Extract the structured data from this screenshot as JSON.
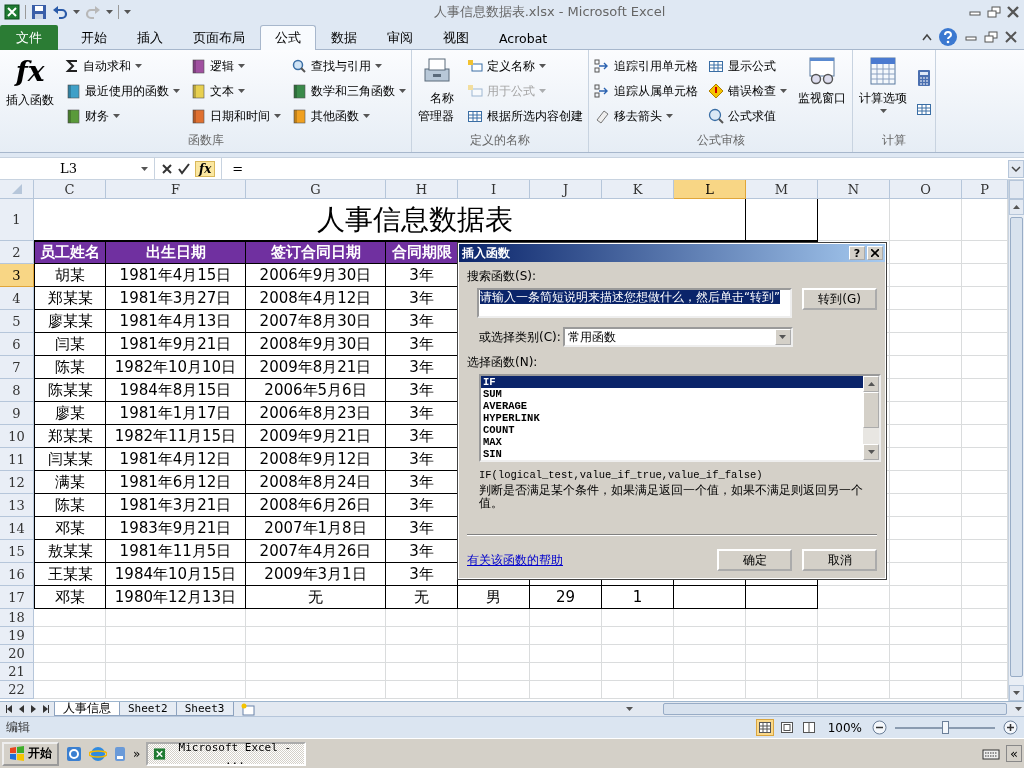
{
  "window": {
    "title": "人事信息数据表.xlsx - Microsoft Excel"
  },
  "ribbon_tabs": [
    {
      "label": "文件",
      "kind": "file",
      "selected": false
    },
    {
      "label": "开始",
      "kind": "tab",
      "selected": false
    },
    {
      "label": "插入",
      "kind": "tab",
      "selected": false
    },
    {
      "label": "页面布局",
      "kind": "tab",
      "selected": false
    },
    {
      "label": "公式",
      "kind": "tab",
      "selected": true
    },
    {
      "label": "数据",
      "kind": "tab",
      "selected": false
    },
    {
      "label": "审阅",
      "kind": "tab",
      "selected": false
    },
    {
      "label": "视图",
      "kind": "tab",
      "selected": false
    },
    {
      "label": "Acrobat",
      "kind": "tab",
      "selected": false
    }
  ],
  "ribbon_groups": [
    {
      "label": "函数库",
      "parts": [
        {
          "kind": "large",
          "label": "插入函数",
          "icon_text": "fx",
          "dropdown": false
        },
        {
          "kind": "column",
          "items": [
            {
              "label": "自动求和",
              "dropdown": true,
              "disabled": false
            },
            {
              "label": "最近使用的函数",
              "dropdown": true,
              "disabled": false
            },
            {
              "label": "财务",
              "dropdown": true,
              "disabled": false
            }
          ]
        },
        {
          "kind": "column",
          "items": [
            {
              "label": "逻辑",
              "dropdown": true,
              "disabled": false
            },
            {
              "label": "文本",
              "dropdown": true,
              "disabled": false
            },
            {
              "label": "日期和时间",
              "dropdown": true,
              "disabled": false
            }
          ]
        },
        {
          "kind": "column",
          "items": [
            {
              "label": "查找与引用",
              "dropdown": true,
              "disabled": false
            },
            {
              "label": "数学和三角函数",
              "dropdown": true,
              "disabled": false
            },
            {
              "label": "其他函数",
              "dropdown": true,
              "disabled": false
            }
          ]
        }
      ]
    },
    {
      "label": "定义的名称",
      "parts": [
        {
          "kind": "large",
          "label": "名称管理器",
          "dropdown": false
        },
        {
          "kind": "column",
          "items": [
            {
              "label": "定义名称",
              "dropdown": true,
              "disabled": false
            },
            {
              "label": "用于公式",
              "dropdown": true,
              "disabled": true
            },
            {
              "label": "根据所选内容创建",
              "dropdown": false,
              "disabled": false
            }
          ]
        }
      ]
    },
    {
      "label": "公式审核",
      "parts": [
        {
          "kind": "column",
          "items": [
            {
              "label": "追踪引用单元格",
              "dropdown": false,
              "disabled": false
            },
            {
              "label": "追踪从属单元格",
              "dropdown": false,
              "disabled": false
            },
            {
              "label": "移去箭头",
              "dropdown": true,
              "disabled": false
            }
          ]
        },
        {
          "kind": "column",
          "items": [
            {
              "label": "显示公式",
              "dropdown": false,
              "disabled": false
            },
            {
              "label": "错误检查",
              "dropdown": true,
              "disabled": false
            },
            {
              "label": "公式求值",
              "dropdown": false,
              "disabled": false
            }
          ]
        },
        {
          "kind": "large",
          "label": "监视窗口",
          "dropdown": false
        }
      ]
    },
    {
      "label": "计算",
      "parts": [
        {
          "kind": "large",
          "label": "计算选项",
          "dropdown": true
        },
        {
          "kind": "icon_column"
        }
      ]
    }
  ],
  "formula_bar": {
    "name_box": "L3",
    "fx_button": "fx",
    "formula": "="
  },
  "sheet": {
    "columns": [
      {
        "label": "C",
        "selected": false
      },
      {
        "label": "F",
        "selected": false
      },
      {
        "label": "G",
        "selected": false
      },
      {
        "label": "H",
        "selected": false
      },
      {
        "label": "I",
        "selected": false
      },
      {
        "label": "J",
        "selected": false
      },
      {
        "label": "K",
        "selected": false
      },
      {
        "label": "L",
        "selected": true
      },
      {
        "label": "M",
        "selected": false
      },
      {
        "label": "N",
        "selected": false
      },
      {
        "label": "O",
        "selected": false
      },
      {
        "label": "P",
        "selected": false
      }
    ],
    "rows": [
      {
        "kind": "title",
        "number": "1",
        "selected": false,
        "cells": [
          "人事信息数据表"
        ]
      },
      {
        "kind": "header",
        "number": "2",
        "selected": false,
        "cells": [
          "员工姓名",
          "出生日期",
          "签订合同日期",
          "合同期限"
        ]
      },
      {
        "kind": "data",
        "number": "3",
        "selected": true,
        "cells": [
          "胡某",
          "1981年4月15日",
          "2006年9月30日",
          "3年"
        ]
      },
      {
        "kind": "data",
        "number": "4",
        "selected": false,
        "cells": [
          "郑某某",
          "1981年3月27日",
          "2008年4月12日",
          "3年"
        ]
      },
      {
        "kind": "data",
        "number": "5",
        "selected": false,
        "cells": [
          "廖某某",
          "1981年4月13日",
          "2007年8月30日",
          "3年"
        ]
      },
      {
        "kind": "data",
        "number": "6",
        "selected": false,
        "cells": [
          "闫某",
          "1981年9月21日",
          "2008年9月30日",
          "3年"
        ]
      },
      {
        "kind": "data",
        "number": "7",
        "selected": false,
        "cells": [
          "陈某",
          "1982年10月10日",
          "2009年8月21日",
          "3年"
        ]
      },
      {
        "kind": "data",
        "number": "8",
        "selected": false,
        "cells": [
          "陈某某",
          "1984年8月15日",
          "2006年5月6日",
          "3年"
        ]
      },
      {
        "kind": "data",
        "number": "9",
        "selected": false,
        "cells": [
          "廖某",
          "1981年1月17日",
          "2006年8月23日",
          "3年"
        ]
      },
      {
        "kind": "data",
        "number": "10",
        "selected": false,
        "cells": [
          "郑某某",
          "1982年11月15日",
          "2009年9月21日",
          "3年"
        ]
      },
      {
        "kind": "data",
        "number": "11",
        "selected": false,
        "cells": [
          "闫某某",
          "1981年4月12日",
          "2008年9月12日",
          "3年"
        ]
      },
      {
        "kind": "data",
        "number": "12",
        "selected": false,
        "cells": [
          "满某",
          "1981年6月12日",
          "2008年8月24日",
          "3年"
        ]
      },
      {
        "kind": "data",
        "number": "13",
        "selected": false,
        "cells": [
          "陈某",
          "1981年3月21日",
          "2008年6月26日",
          "3年"
        ]
      },
      {
        "kind": "data",
        "number": "14",
        "selected": false,
        "cells": [
          "邓某",
          "1983年9月21日",
          "2007年1月8日",
          "3年"
        ]
      },
      {
        "kind": "data",
        "number": "15",
        "selected": false,
        "cells": [
          "敖某某",
          "1981年11月5日",
          "2007年4月26日",
          "3年"
        ]
      },
      {
        "kind": "data",
        "number": "16",
        "selected": false,
        "cells": [
          "王某某",
          "1984年10月15日",
          "2009年3月1日",
          "3年"
        ]
      },
      {
        "kind": "data",
        "number": "17",
        "selected": false,
        "cells": [
          "邓某",
          "1980年12月13日",
          "无",
          "无",
          "男",
          "29",
          "1"
        ]
      },
      {
        "kind": "empty",
        "number": "18",
        "selected": false
      },
      {
        "kind": "empty",
        "number": "19",
        "selected": false
      },
      {
        "kind": "empty",
        "number": "20",
        "selected": false
      },
      {
        "kind": "empty",
        "number": "21",
        "selected": false
      },
      {
        "kind": "empty",
        "number": "22",
        "selected": false
      }
    ]
  },
  "dialog": {
    "title": "插入函数",
    "help_button": "?",
    "search_label": "搜索函数(S):",
    "search_value": "请输入一条简短说明来描述您想做什么，然后单击“转到”",
    "go_button": "转到(G)",
    "category_label": "或选择类别(C):",
    "category_value": "常用函数",
    "list_label": "选择函数(N):",
    "functions": [
      {
        "label": "IF",
        "selected": true
      },
      {
        "label": "SUM",
        "selected": false
      },
      {
        "label": "AVERAGE",
        "selected": false
      },
      {
        "label": "HYPERLINK",
        "selected": false
      },
      {
        "label": "COUNT",
        "selected": false
      },
      {
        "label": "MAX",
        "selected": false
      },
      {
        "label": "SIN",
        "selected": false
      }
    ],
    "signature": "IF(logical_test,value_if_true,value_if_false)",
    "description": "判断是否满足某个条件，如果满足返回一个值，如果不满足则返回另一个值。",
    "help_link": "有关该函数的帮助",
    "ok_button": "确定",
    "cancel_button": "取消"
  },
  "sheet_tabs": [
    {
      "label": "人事信息",
      "selected": true
    },
    {
      "label": "Sheet2",
      "selected": false
    },
    {
      "label": "Sheet3",
      "selected": false
    }
  ],
  "status_bar": {
    "mode": "编辑",
    "views": [
      {
        "selected": true
      },
      {
        "selected": false
      },
      {
        "selected": false
      }
    ],
    "zoom": "100%",
    "zoom_slider": {
      "level": 0.5
    }
  },
  "taskbar": {
    "start": "开始",
    "overflow": "»",
    "tasks": [
      {
        "label": "Microsoft Excel - ...",
        "selected": true
      }
    ],
    "tray_button": "«"
  }
}
